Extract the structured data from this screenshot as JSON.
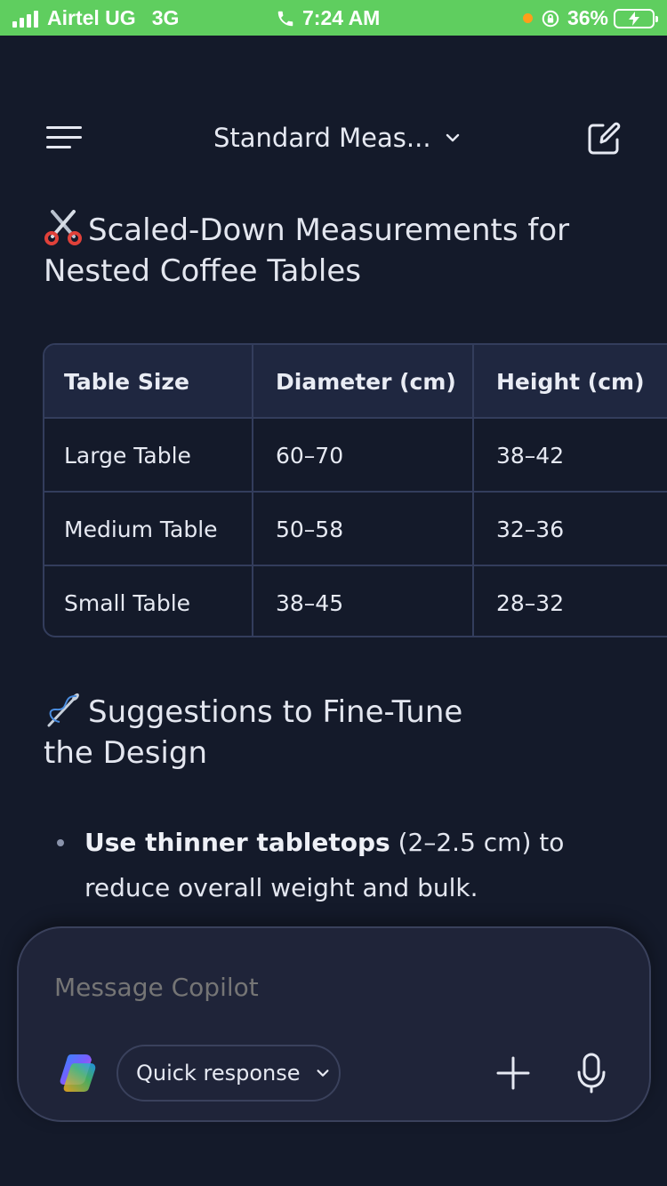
{
  "status_bar": {
    "carrier": "Airtel UG",
    "network": "3G",
    "time": "7:24 AM",
    "battery": "36%"
  },
  "header": {
    "title": "Standard Meas..."
  },
  "sections": [
    {
      "heading": "Scaled-Down Measurements for Nested Coffee Tables",
      "emoji": "scissors-icon"
    },
    {
      "heading": "Suggestions to Fine-Tune the Design",
      "emoji": "sewing-needle-icon"
    }
  ],
  "table": {
    "headers": [
      "Table Size",
      "Diameter (cm)",
      "Height (cm)"
    ],
    "rows": [
      [
        "Large Table",
        "60–70",
        "38–42"
      ],
      [
        "Medium Table",
        "50–58",
        "32–36"
      ],
      [
        "Small Table",
        "38–45",
        "28–32"
      ]
    ]
  },
  "bullets": [
    {
      "bold": "Use thinner tabletops",
      "text": " (2–2.5 cm) to reduce overall weight and bulk."
    }
  ],
  "composer": {
    "placeholder": "Message Copilot",
    "mode_label": "Quick response"
  },
  "colors": {
    "background": "#141a2a",
    "status_bar": "#5fce5f",
    "table_border": "#333d5c",
    "composer_bg": "#1f2439"
  }
}
